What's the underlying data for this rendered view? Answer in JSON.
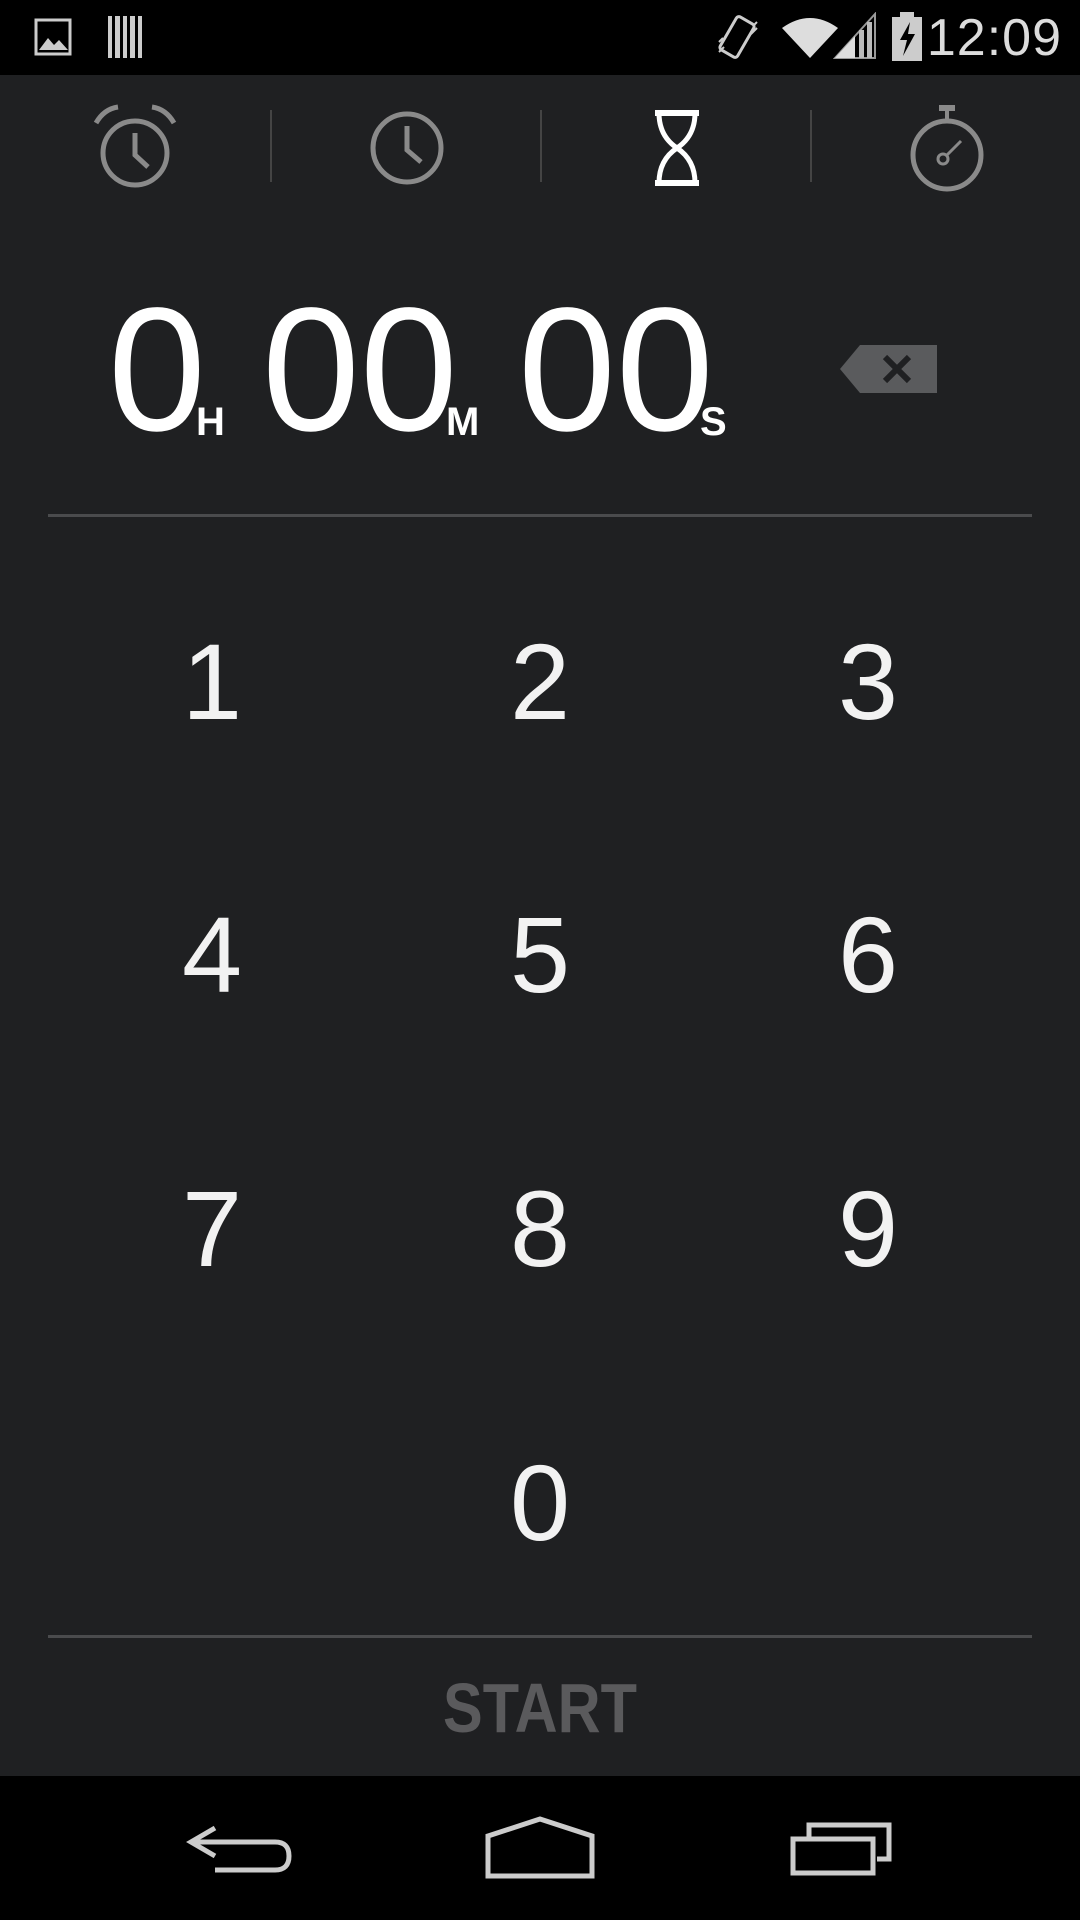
{
  "status_bar": {
    "time": "12:09",
    "icons": [
      "gallery-icon",
      "barcode-icon",
      "vibrate-icon",
      "wifi-icon",
      "signal-icon",
      "battery-charging-icon"
    ]
  },
  "tabs": [
    {
      "name": "alarm",
      "icon": "alarm-clock-icon",
      "selected": false
    },
    {
      "name": "clock",
      "icon": "clock-icon",
      "selected": false
    },
    {
      "name": "timer",
      "icon": "hourglass-icon",
      "selected": true
    },
    {
      "name": "stopwatch",
      "icon": "stopwatch-icon",
      "selected": false
    }
  ],
  "timer_display": {
    "hours": "0",
    "hours_unit": "H",
    "minutes": "00",
    "minutes_unit": "M",
    "seconds": "00",
    "seconds_unit": "S"
  },
  "keypad": {
    "k1": "1",
    "k2": "2",
    "k3": "3",
    "k4": "4",
    "k5": "5",
    "k6": "6",
    "k7": "7",
    "k8": "8",
    "k9": "9",
    "k0": "0"
  },
  "start_label": "START",
  "colors": {
    "background": "#1f2022",
    "divider": "#4a4b4d",
    "start_disabled": "#5a5a5c",
    "tab_inactive": "#8a8a8a",
    "tab_active": "#ffffff"
  }
}
